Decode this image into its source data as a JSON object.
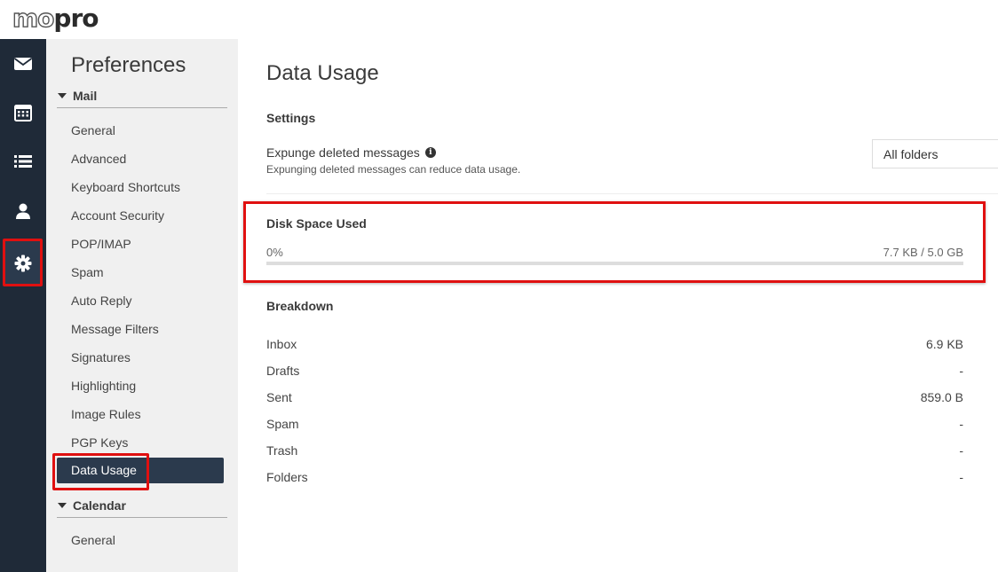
{
  "app": {
    "logo_left": "mo",
    "logo_right": "pro"
  },
  "iconbar": [
    {
      "icon": "mail-icon",
      "active": false
    },
    {
      "icon": "calendar-icon",
      "active": false
    },
    {
      "icon": "list-icon",
      "active": false
    },
    {
      "icon": "contacts-icon",
      "active": false
    },
    {
      "icon": "gear-icon",
      "active": true
    }
  ],
  "preferences": {
    "title": "Preferences",
    "mail_section": "Mail",
    "mail_items": [
      "General",
      "Advanced",
      "Keyboard Shortcuts",
      "Account Security",
      "POP/IMAP",
      "Spam",
      "Auto Reply",
      "Message Filters",
      "Signatures",
      "Highlighting",
      "Image Rules",
      "PGP Keys",
      "Data Usage"
    ],
    "active_item": "Data Usage",
    "calendar_section": "Calendar",
    "calendar_items": [
      "General"
    ]
  },
  "main": {
    "title": "Data Usage",
    "settings_heading": "Settings",
    "expunge_label": "Expunge deleted messages",
    "expunge_desc": "Expunging deleted messages can reduce data usage.",
    "expunge_value": "All folders",
    "disk_heading": "Disk Space Used",
    "disk_percent": "0%",
    "disk_percent_value": 0,
    "disk_amount": "7.7 KB / 5.0 GB",
    "breakdown_heading": "Breakdown",
    "breakdown": [
      {
        "name": "Inbox",
        "value": "6.9 KB"
      },
      {
        "name": "Drafts",
        "value": "-"
      },
      {
        "name": "Sent",
        "value": "859.0 B"
      },
      {
        "name": "Spam",
        "value": "-"
      },
      {
        "name": "Trash",
        "value": "-"
      },
      {
        "name": "Folders",
        "value": "-"
      }
    ]
  },
  "colors": {
    "sidebar": "#1f2a38",
    "active": "#2b3a4d",
    "highlight": "#e01010"
  }
}
